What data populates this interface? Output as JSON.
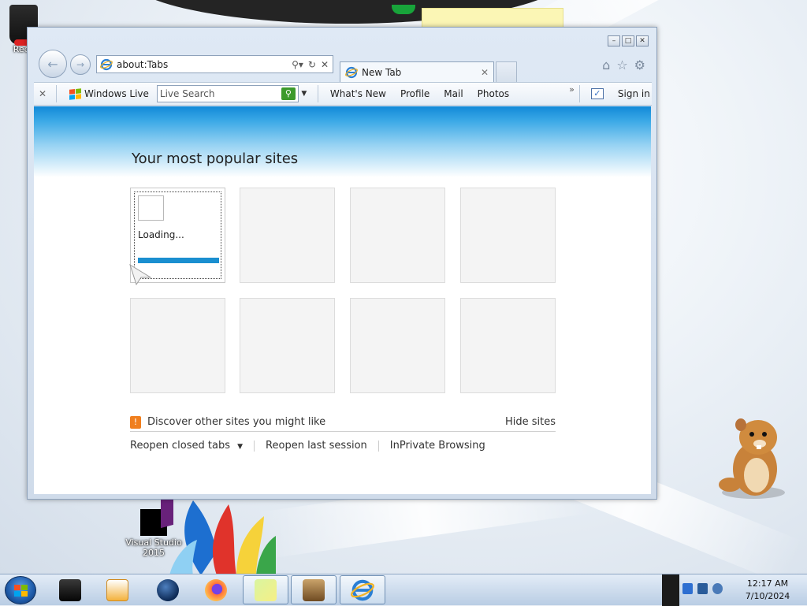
{
  "desktop": {
    "icons": [
      {
        "label": "Recy"
      },
      {
        "label": "Visual Studio 2015"
      }
    ]
  },
  "browser": {
    "address": "about:Tabs",
    "tab_title": "New Tab",
    "command_bar": {
      "windows_live": "Windows Live",
      "search_placeholder": "Live Search",
      "links": [
        "What's New",
        "Profile",
        "Mail",
        "Photos"
      ],
      "more": "»",
      "sign_in": "Sign in"
    },
    "content": {
      "heading": "Your most popular sites",
      "loading_text": "Loading...",
      "discover": "Discover other sites you might like",
      "hide_sites": "Hide sites",
      "reopen_closed_tabs": "Reopen closed tabs",
      "reopen_last_session": "Reopen last session",
      "inprivate": "InPrivate Browsing"
    }
  },
  "taskbar": {
    "clock_time": "12:17 AM",
    "clock_date": "7/10/2024"
  },
  "colors": {
    "accent_blue": "#1289d8",
    "loading_bar": "#1a8fd0",
    "bulb_orange": "#f07f1e",
    "search_green": "#3c9a2c"
  }
}
